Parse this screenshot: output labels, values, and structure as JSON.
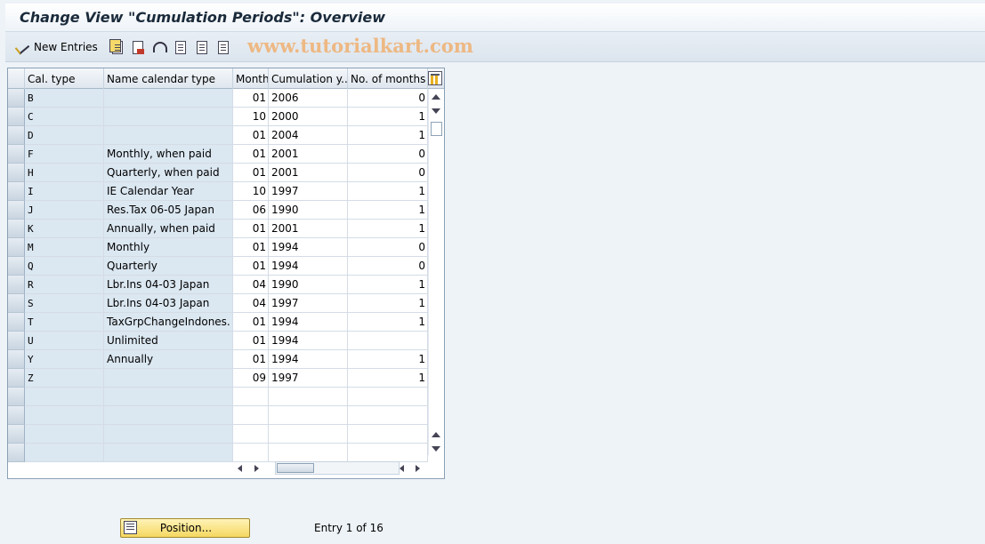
{
  "window": {
    "title": "Change View \"Cumulation Periods\": Overview"
  },
  "toolbar": {
    "new_entries_label": "New Entries",
    "watermark": "www.tutorialkart.com",
    "icons": [
      "choose-icon",
      "copy-as-icon",
      "delete-icon",
      "undo-icon",
      "select-all-icon",
      "select-block-icon",
      "deselect-all-icon"
    ]
  },
  "table": {
    "headers": [
      "Cal. type",
      "Name calendar type",
      "Month",
      "Cumulation y...",
      "No. of months"
    ],
    "rows": [
      {
        "type": "B",
        "name": "",
        "month": "01",
        "year": "2006",
        "months": "0"
      },
      {
        "type": "C",
        "name": "",
        "month": "10",
        "year": "2000",
        "months": "1"
      },
      {
        "type": "D",
        "name": "",
        "month": "01",
        "year": "2004",
        "months": "1"
      },
      {
        "type": "F",
        "name": "Monthly, when paid",
        "month": "01",
        "year": "2001",
        "months": "0"
      },
      {
        "type": "H",
        "name": "Quarterly, when paid",
        "month": "01",
        "year": "2001",
        "months": "0"
      },
      {
        "type": "I",
        "name": "IE Calendar Year",
        "month": "10",
        "year": "1997",
        "months": "1"
      },
      {
        "type": "J",
        "name": "Res.Tax 06-05  Japan",
        "month": "06",
        "year": "1990",
        "months": "1"
      },
      {
        "type": "K",
        "name": "Annually, when paid",
        "month": "01",
        "year": "2001",
        "months": "1"
      },
      {
        "type": "M",
        "name": "Monthly",
        "month": "01",
        "year": "1994",
        "months": "0"
      },
      {
        "type": "Q",
        "name": "Quarterly",
        "month": "01",
        "year": "1994",
        "months": "0"
      },
      {
        "type": "R",
        "name": "Lbr.Ins 04-03  Japan",
        "month": "04",
        "year": "1990",
        "months": "1"
      },
      {
        "type": "S",
        "name": "Lbr.Ins 04-03  Japan",
        "month": "04",
        "year": "1997",
        "months": "1"
      },
      {
        "type": "T",
        "name": "TaxGrpChangeIndones.",
        "month": "01",
        "year": "1994",
        "months": "1"
      },
      {
        "type": "U",
        "name": "Unlimited",
        "month": "01",
        "year": "1994",
        "months": ""
      },
      {
        "type": "Y",
        "name": "Annually",
        "month": "01",
        "year": "1994",
        "months": "1"
      },
      {
        "type": "Z",
        "name": "",
        "month": "09",
        "year": "1997",
        "months": "1"
      },
      {
        "type": "",
        "name": "",
        "month": "",
        "year": "",
        "months": ""
      },
      {
        "type": "",
        "name": "",
        "month": "",
        "year": "",
        "months": ""
      },
      {
        "type": "",
        "name": "",
        "month": "",
        "year": "",
        "months": ""
      },
      {
        "type": "",
        "name": "",
        "month": "",
        "year": "",
        "months": ""
      }
    ]
  },
  "footer": {
    "position_label": "Position...",
    "entry_info": "Entry 1 of 16"
  }
}
